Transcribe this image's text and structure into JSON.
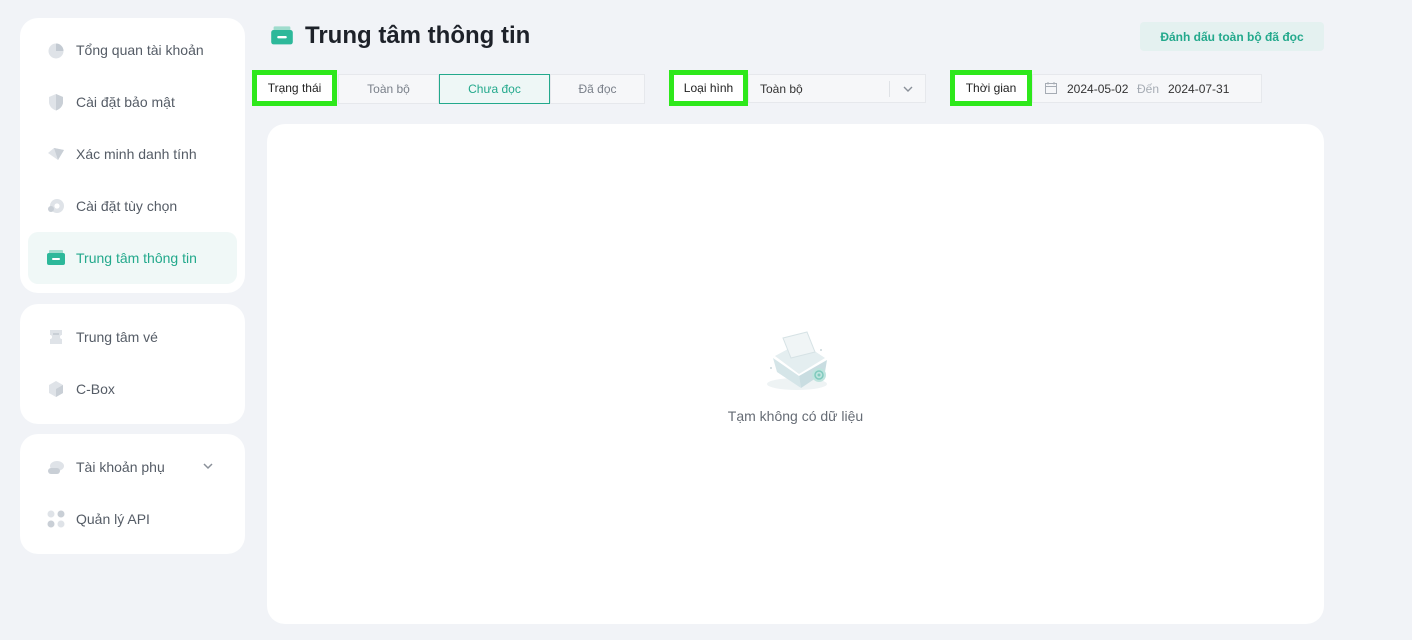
{
  "sidebar": {
    "group1": [
      {
        "label": "Tổng quan tài khoản",
        "icon": "pie-chart-icon"
      },
      {
        "label": "Cài đặt bảo mật",
        "icon": "shield-icon"
      },
      {
        "label": "Xác minh danh tính",
        "icon": "diamond-id-icon"
      },
      {
        "label": "Cài đặt tùy chọn",
        "icon": "gear-icon"
      },
      {
        "label": "Trung tâm thông tin",
        "icon": "message-box-icon",
        "active": true
      }
    ],
    "group2": [
      {
        "label": "Trung tâm vé",
        "icon": "ticket-icon"
      },
      {
        "label": "C-Box",
        "icon": "cube-icon"
      }
    ],
    "group3": [
      {
        "label": "Tài khoản phụ",
        "icon": "sub-account-icon",
        "has_dropdown": true
      },
      {
        "label": "Quản lý API",
        "icon": "api-icon"
      }
    ]
  },
  "header": {
    "title": "Trung tâm thông tin",
    "mark_all_read": "Đánh dấu toàn bộ đã đọc"
  },
  "filters": {
    "status": {
      "label": "Trạng thái",
      "options": [
        "Toàn bộ",
        "Chưa đọc",
        "Đã đọc"
      ],
      "selected": "Chưa đọc"
    },
    "type": {
      "label": "Loại hình",
      "value": "Toàn bộ"
    },
    "time": {
      "label": "Thời gian",
      "start": "2024-05-02",
      "separator": "Đến",
      "end": "2024-07-31"
    }
  },
  "content": {
    "empty_text": "Tạm không có dữ liệu"
  },
  "colors": {
    "accent": "#23a98c",
    "highlight_box": "#2ee81b",
    "background": "#f1f3f7"
  }
}
